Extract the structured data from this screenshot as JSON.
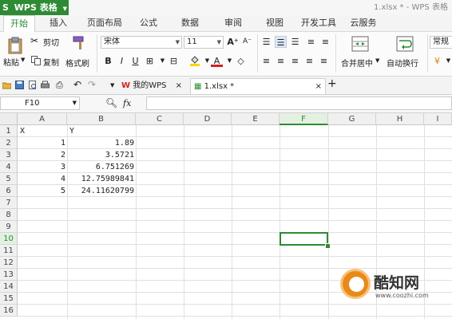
{
  "app": {
    "name": "WPS 表格",
    "logo": "S",
    "window_title": "1.xlsx * - WPS 表格"
  },
  "menu": [
    "开始",
    "插入",
    "页面布局",
    "公式",
    "数据",
    "审阅",
    "视图",
    "开发工具",
    "云服务"
  ],
  "ribbon": {
    "paste": "粘贴",
    "cut": "剪切",
    "copy": "复制",
    "format_painter": "格式刷",
    "font_name": "宋体",
    "font_size": "11",
    "bold": "B",
    "italic": "I",
    "underline": "U",
    "merge_center": "合并居中",
    "wrap_text": "自动换行",
    "number_format": "常规"
  },
  "tabs": {
    "home": "我的WPS",
    "file": "1.xlsx *",
    "add": "+"
  },
  "formula_bar": {
    "name_box": "F10",
    "fx": "fx",
    "value": ""
  },
  "colors": {
    "accent": "#2e8b34",
    "watermark": "#e88a1a"
  },
  "columns": [
    "A",
    "B",
    "C",
    "D",
    "E",
    "F",
    "G",
    "H",
    "I"
  ],
  "rows": [
    "1",
    "2",
    "3",
    "4",
    "5",
    "6",
    "7",
    "8",
    "9",
    "10",
    "11",
    "12",
    "13",
    "14",
    "15",
    "16"
  ],
  "cells": {
    "A1": "X",
    "B1": "Y",
    "A2": "1",
    "B2": "1.89",
    "A3": "2",
    "B3": "3.5721",
    "A4": "3",
    "B4": "6.751269",
    "A5": "4",
    "B5": "12.75989841",
    "A6": "5",
    "B6": "24.11620799"
  },
  "watermark": {
    "title": "酷知网",
    "url": "www.coozhi.com"
  }
}
